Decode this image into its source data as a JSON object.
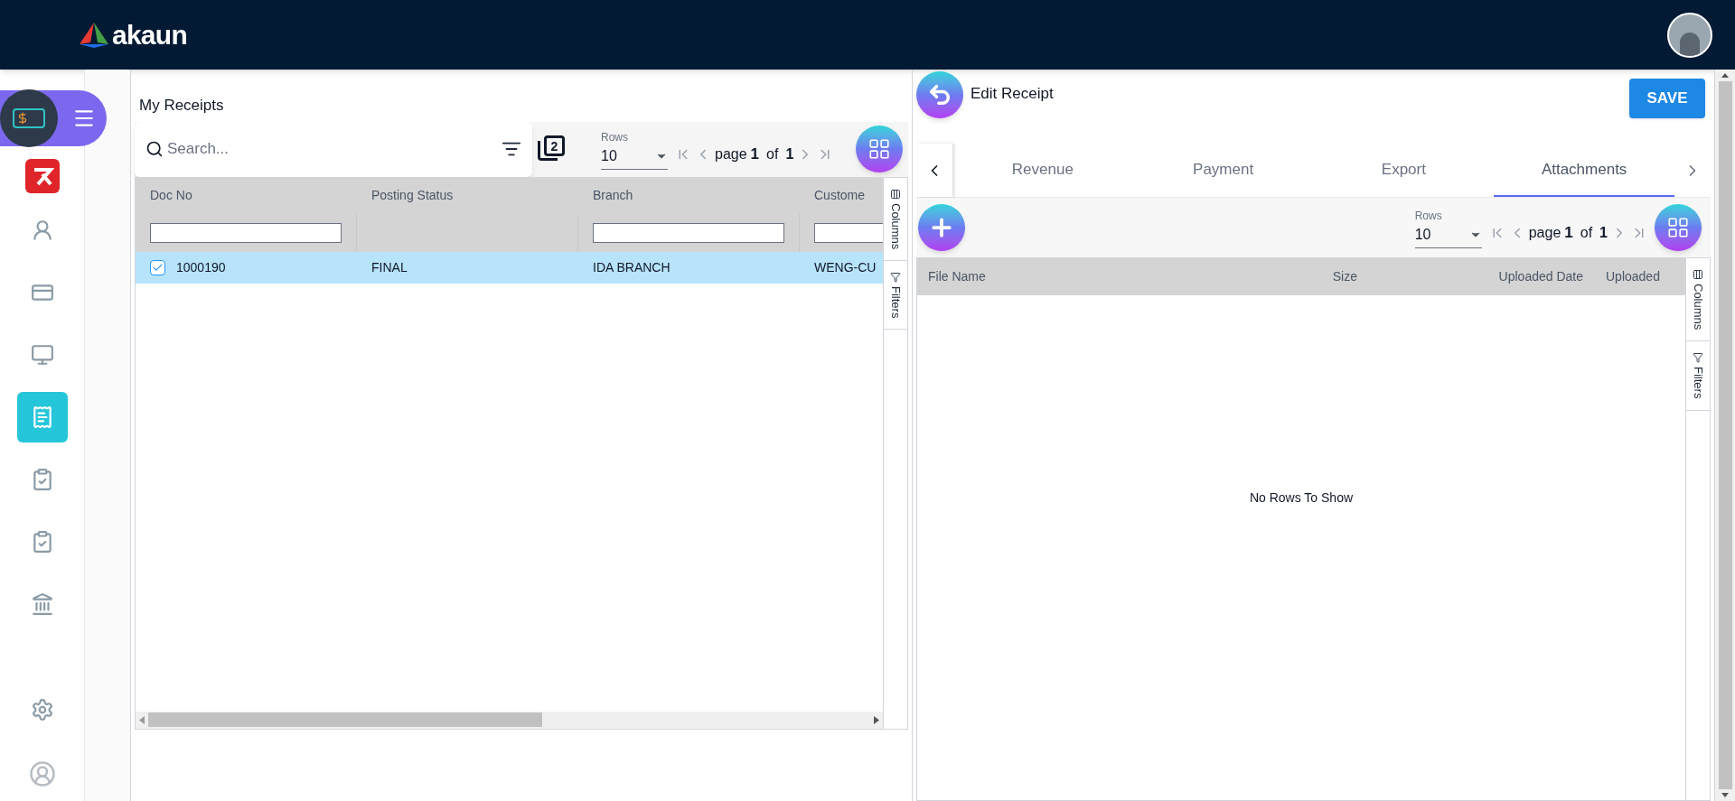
{
  "header": {
    "logo_text": "akaun"
  },
  "sidebar": {
    "items": [
      {
        "selected": false
      },
      {
        "selected": false
      },
      {
        "selected": false
      },
      {
        "selected": true
      },
      {
        "selected": false
      },
      {
        "selected": false
      },
      {
        "selected": false
      }
    ]
  },
  "left_panel": {
    "title": "My Receipts",
    "search": {
      "placeholder": "Search..."
    },
    "stack_count": "2",
    "rows_label": "Rows",
    "rows_value": "10",
    "pager": {
      "prefix": "page",
      "current": "1",
      "of": "of",
      "total": "1"
    },
    "columns": [
      {
        "label": "Doc No",
        "filter": true
      },
      {
        "label": "Posting Status",
        "filter": false
      },
      {
        "label": "Branch",
        "filter": true
      },
      {
        "label": "Custome",
        "filter": true
      }
    ],
    "rows": [
      {
        "selected": true,
        "cells": [
          "1000190",
          "FINAL",
          "IDA BRANCH",
          "WENG-CU"
        ]
      }
    ],
    "side_tabs": [
      "Columns",
      "Filters"
    ]
  },
  "right_panel": {
    "title": "Edit Receipt",
    "save": "SAVE",
    "tabs": [
      {
        "label": "Revenue",
        "selected": false
      },
      {
        "label": "Payment",
        "selected": false
      },
      {
        "label": "Export",
        "selected": false
      },
      {
        "label": "Attachments",
        "selected": true
      }
    ],
    "rows_label": "Rows",
    "rows_value": "10",
    "pager": {
      "prefix": "page",
      "current": "1",
      "of": "of",
      "total": "1"
    },
    "columns": [
      {
        "label": "File Name"
      },
      {
        "label": "Size"
      },
      {
        "label": "Uploaded Date"
      },
      {
        "label": "Uploaded"
      }
    ],
    "empty_message": "No Rows To Show",
    "side_tabs": [
      "Columns",
      "Filters"
    ]
  }
}
